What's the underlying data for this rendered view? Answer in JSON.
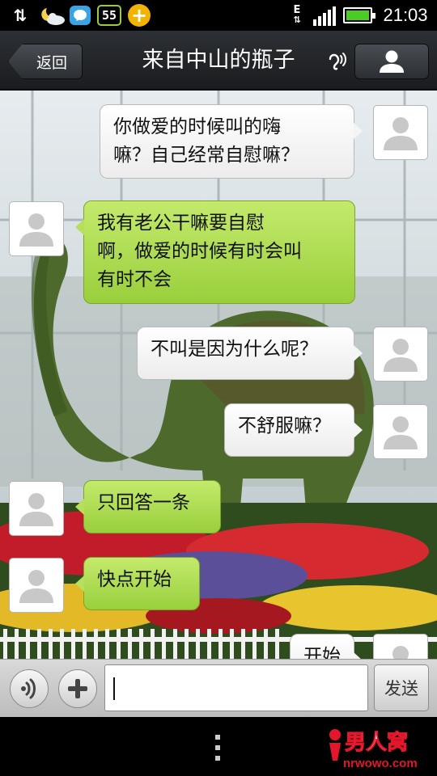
{
  "status_bar": {
    "badge_number": "55",
    "network_type": "E",
    "time": "21:03",
    "icons": [
      "data-sync-icon",
      "weather-icon",
      "chat-notification-icon",
      "counter-badge-icon",
      "plus-app-icon",
      "network-arrows-icon",
      "signal-icon",
      "battery-icon"
    ]
  },
  "header": {
    "back_label": "返回",
    "title": "来自中山的瓶子",
    "icons": [
      "ear-mode-icon",
      "profile-icon"
    ]
  },
  "messages": [
    {
      "side": "me",
      "text_lines": [
        "你做爱的时候叫的嗨",
        "嘛？自己经常自慰嘛？"
      ]
    },
    {
      "side": "them",
      "text_lines": [
        "我有老公干嘛要自慰",
        "啊，做爱的时候有时会叫",
        "有时不会"
      ]
    },
    {
      "side": "me",
      "text_lines": [
        "不叫是因为什么呢？"
      ]
    },
    {
      "side": "me",
      "text_lines": [
        "不舒服嘛？"
      ]
    },
    {
      "side": "them",
      "text_lines": [
        "只回答一条"
      ]
    },
    {
      "side": "them",
      "text_lines": [
        "快点开始"
      ]
    },
    {
      "side": "me",
      "text_lines": [
        "开始"
      ]
    }
  ],
  "input_bar": {
    "text_value": "",
    "send_label": "发送",
    "icons": [
      "voice-icon",
      "plus-icon"
    ]
  },
  "watermark": {
    "brand": "男人窝",
    "url": "nrwowo.com"
  },
  "colors": {
    "incoming_bubble": "#a9d84a",
    "outgoing_bubble": "#f4f4f4",
    "header_bg": "#24272b",
    "battery": "#4ccb27"
  }
}
